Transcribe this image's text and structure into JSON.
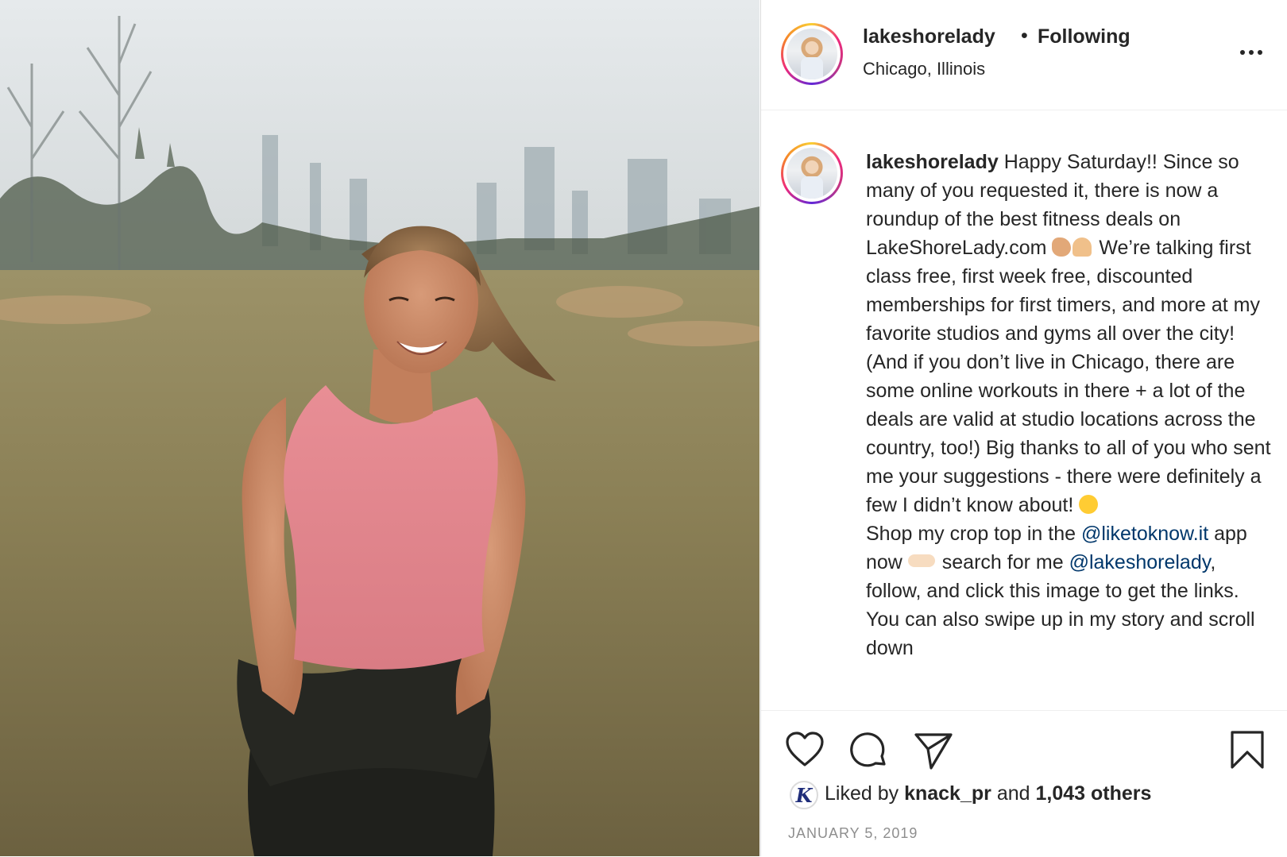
{
  "post": {
    "image_alt": "Smiling woman in a pink crop top standing in a park with the Chicago skyline behind her",
    "header": {
      "username": "lakeshorelady",
      "separator": "•",
      "follow_status": "Following",
      "location": "Chicago, Illinois",
      "more_icon": "more-options-icon"
    },
    "caption": {
      "username": "lakeshorelady",
      "text_1": "Happy Saturday!! Since so many of you requested it, there is now a roundup of the best fitness deals on LakeShoreLady.com",
      "text_2": "We’re talking first class free, first week free, discounted memberships for first timers, and more at my favorite studios and gyms all over the city! (And if you don’t live in Chicago, there are some online workouts in there + a lot of the deals are valid at studio locations across the country, too!) Big thanks to all of you who sent me your suggestions - there were definitely a few I didn’t know about!",
      "text_3": "Shop my crop top in the",
      "mention_1": "@liketoknow.it",
      "text_4": "app now",
      "text_5": "search for me",
      "mention_2": "@lakeshorelady",
      "text_6": ", follow, and click this image to get the links. You can also",
      "text_7": "swipe up in my story and scroll down"
    },
    "actions": {
      "icons": [
        "heart-icon",
        "comment-icon",
        "share-icon",
        "bookmark-icon"
      ]
    },
    "likes": {
      "liker_initial": "K",
      "prefix": "Liked by",
      "liker": "knack_pr",
      "middle": "and",
      "others": "1,043 others"
    },
    "date": "JANUARY 5, 2019"
  }
}
